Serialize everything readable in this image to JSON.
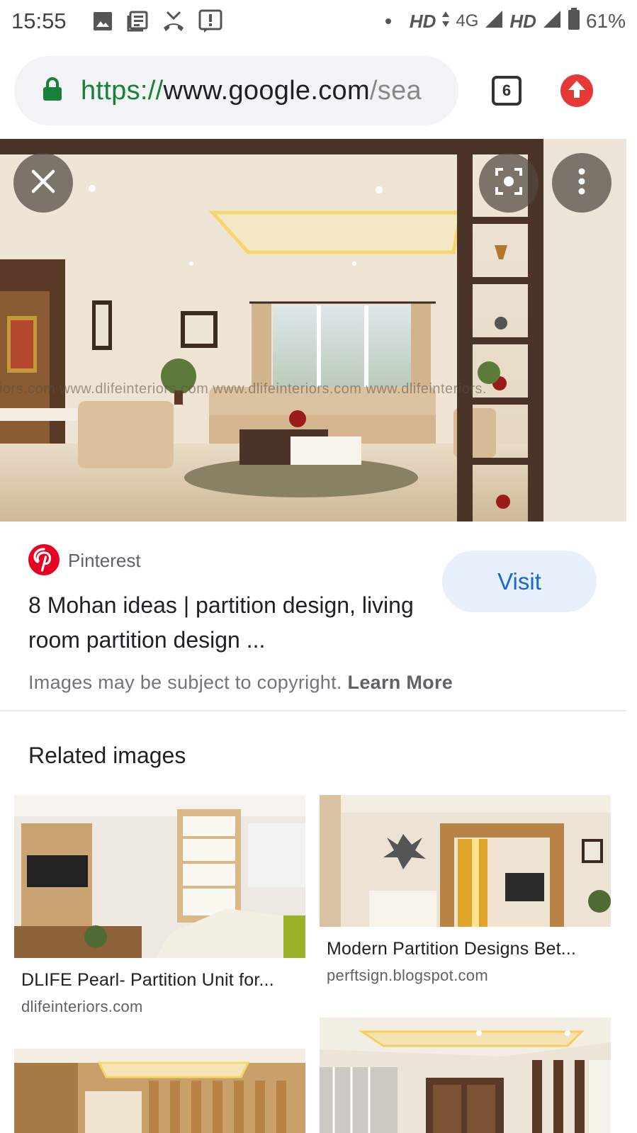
{
  "status_bar": {
    "time": "15:55",
    "network_label": "HD",
    "network_type": "4G",
    "network_label_2": "HD",
    "battery": "61%"
  },
  "address_bar": {
    "url_scheme": "https://",
    "url_host": "www.google.com",
    "url_path": "/sea",
    "tab_count": "6"
  },
  "hero": {
    "watermark": "eriors.com  www.dlifeinteriors.com  www.dlifeinteriors.com  www.dlifeinteriors."
  },
  "result": {
    "source": "Pinterest",
    "title": "8 Mohan ideas | partition design, living room partition design ...",
    "visit_label": "Visit",
    "copyright_text": "Images may be subject to copyright.",
    "learn_more": "Learn More"
  },
  "related": {
    "heading": "Related images",
    "items": [
      {
        "title": "DLIFE Pearl- Partition Unit for...",
        "domain": "dlifeinteriors.com"
      },
      {
        "title": "Modern Partition Designs Bet...",
        "domain": "perftsign.blogspot.com"
      }
    ]
  },
  "colors": {
    "accent_blue": "#1967d2",
    "pinterest_red": "#e60023",
    "secure_green": "#188038",
    "update_red": "#e53935"
  }
}
